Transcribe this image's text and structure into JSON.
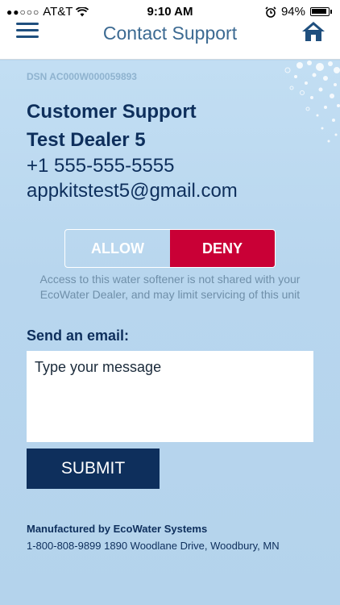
{
  "status_bar": {
    "signal": "●●○○○",
    "carrier": "AT&T",
    "time": "9:10 AM",
    "battery": "94%"
  },
  "nav": {
    "title": "Contact Support"
  },
  "device": {
    "dsn": "DSN AC000W000059893"
  },
  "dealer": {
    "support_title": "Customer Support",
    "name": "Test Dealer 5",
    "phone": "+1 555-555-5555",
    "email": "appkitstest5@gmail.com"
  },
  "access_toggle": {
    "allow_label": "ALLOW",
    "deny_label": "DENY",
    "selected": "DENY",
    "note": "Access to this water softener is not shared with your EcoWater Dealer, and may limit servicing of this unit"
  },
  "email_form": {
    "label": "Send an email:",
    "placeholder": "Type your message",
    "submit_label": "SUBMIT"
  },
  "footer": {
    "manufacturer": "Manufactured by EcoWater Systems",
    "address": "1-800-808-9899 1890 Woodlane Drive, Woodbury, MN"
  },
  "colors": {
    "accent": "#0e2f5c",
    "deny": "#c90036",
    "background": "#b9d7ee"
  }
}
